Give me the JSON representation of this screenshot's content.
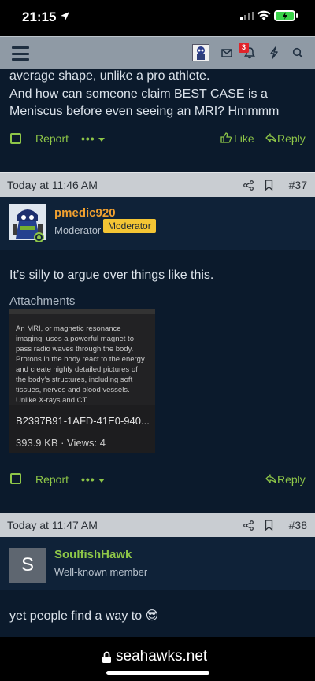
{
  "status_bar": {
    "time": "21:15"
  },
  "navbar": {
    "alert_count": "3"
  },
  "prev_post": {
    "text_line1": "average shape, unlike a pro athlete.",
    "text_line2": "And how can someone claim BEST CASE is a",
    "text_line3": "Meniscus before even seeing an MRI? Hmmmm",
    "report_label": "Report",
    "dots": "•••",
    "like_label": "Like",
    "reply_label": "Reply"
  },
  "post37": {
    "date": "Today at 11:46 AM",
    "number": "#37",
    "username": "pmedic920",
    "user_title": "Moderator",
    "badge": "Moderator",
    "body": "It’s silly to argue over things like this.",
    "attachments_label": "Attachments",
    "attachment": {
      "preview_text": "An MRI, or magnetic resonance imaging, uses a powerful magnet to pass radio waves through the body. Protons in the body react to the energy and create highly detailed pictures of the body’s structures, including soft tissues, nerves and blood vessels. Unlike X-rays and CT",
      "filename": "B2397B91-1AFD-41E0-940...",
      "meta": "393.9 KB · Views: 4"
    },
    "report_label": "Report",
    "dots": "•••",
    "reply_label": "Reply"
  },
  "post38": {
    "date": "Today at 11:47 AM",
    "number": "#38",
    "avatar_letter": "S",
    "username": "SoulfishHawk",
    "user_title": "Well-known member",
    "body": "yet people find a way to",
    "emoji": "😎"
  },
  "browser": {
    "url": "seahawks.net"
  },
  "colors": {
    "accent_green": "#8ec648",
    "username_orange": "#f0a030",
    "badge_yellow": "#f4c534",
    "header_gray": "#c9cdd2",
    "page_bg": "#0b1a2c"
  }
}
